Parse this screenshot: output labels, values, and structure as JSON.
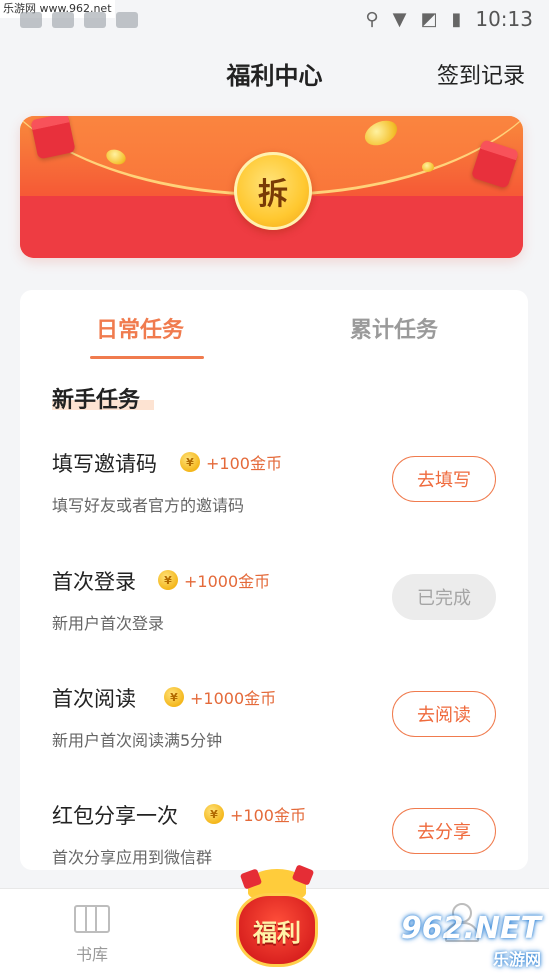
{
  "status_bar": {
    "watermark": "乐游网 www.962.net",
    "time": "10:13"
  },
  "header": {
    "title": "福利中心",
    "records_link": "签到记录"
  },
  "banner": {
    "open_label": "拆"
  },
  "tabs": [
    {
      "label": "日常任务",
      "active": true
    },
    {
      "label": "累计任务",
      "active": false
    }
  ],
  "section": {
    "title": "新手任务"
  },
  "tasks": [
    {
      "name": "填写邀请码",
      "coin_symbol": "¥",
      "reward": "+100金币",
      "description": "填写好友或者官方的邀请码",
      "button": "去填写",
      "done": false
    },
    {
      "name": "首次登录",
      "coin_symbol": "¥",
      "reward": "+1000金币",
      "description": "新用户首次登录",
      "button": "已完成",
      "done": true
    },
    {
      "name": "首次阅读",
      "coin_symbol": "¥",
      "reward": "+1000金币",
      "description": "新用户首次阅读满5分钟",
      "button": "去阅读",
      "done": false
    },
    {
      "name": "红包分享一次",
      "coin_symbol": "¥",
      "reward": "+100金币",
      "description": "首次分享应用到微信群",
      "button": "去分享",
      "done": false
    }
  ],
  "bottom_nav": {
    "library_label": "书库",
    "welfare_label": "福利",
    "brand_text": "962.NET",
    "brand_sub": "乐游网"
  },
  "colors": {
    "accent": "#f07b4e",
    "done_bg": "#ececec",
    "banner_red": "#ee3c42"
  }
}
